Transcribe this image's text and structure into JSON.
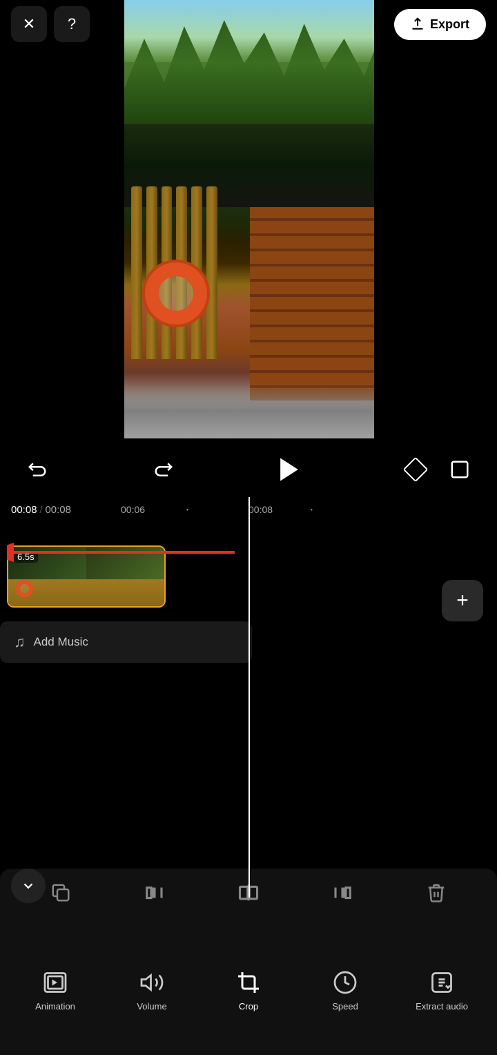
{
  "topBar": {
    "closeLabel": "✕",
    "helpLabel": "?",
    "exportLabel": "Export",
    "exportIcon": "↑"
  },
  "playback": {
    "currentTime": "00:08",
    "totalTime": "00:08",
    "midTime": "00:06",
    "endTime": "00:08"
  },
  "clip": {
    "duration": "6.5s"
  },
  "addMusic": {
    "label": "Add Music"
  },
  "toolbar1": {
    "buttons": [
      "duplicate",
      "trim-left",
      "split",
      "trim-right",
      "delete"
    ]
  },
  "toolbar2": {
    "items": [
      {
        "id": "animation",
        "label": "Animation",
        "icon": "animation"
      },
      {
        "id": "volume",
        "label": "Volume",
        "icon": "volume"
      },
      {
        "id": "crop",
        "label": "Crop",
        "icon": "crop"
      },
      {
        "id": "speed",
        "label": "Speed",
        "icon": "speed"
      },
      {
        "id": "extract-audio",
        "label": "Extract audio",
        "icon": "extract-audio"
      }
    ],
    "activeItem": "crop"
  },
  "colors": {
    "accent": "#e8a020",
    "background": "#000000",
    "surface": "#1a1a1a",
    "toolbar": "#111111",
    "white": "#ffffff"
  }
}
